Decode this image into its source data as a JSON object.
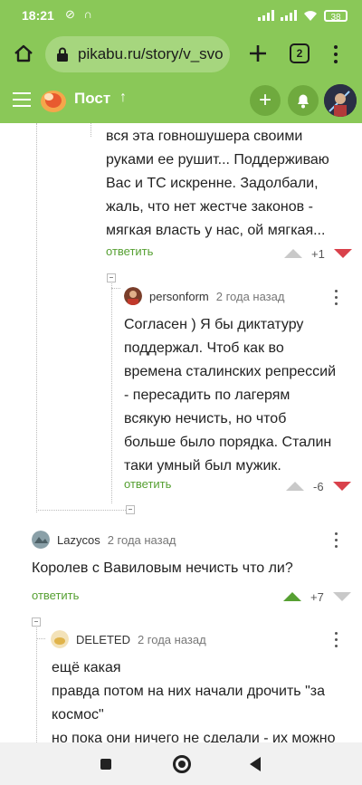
{
  "status_bar": {
    "time": "18:21",
    "left_icons": "⊘ ∩",
    "battery": "38"
  },
  "browser": {
    "url": "pikabu.ru/story/v_svoy",
    "tab_count": "2"
  },
  "site_header": {
    "title": "Пост",
    "arrow": "↑"
  },
  "comments": [
    {
      "lines": [
        "вся эта говношушера своими",
        "руками ее рушит... Поддерживаю",
        "Вас и ТС искренне. Задолбали,",
        "жаль, что нет жестче законов -",
        "мягкая власть у нас, ой мягкая..."
      ],
      "reply": "ответить",
      "rating": "+1"
    },
    {
      "author": "personform",
      "date": "2 года назад",
      "lines": [
        "Согласен ) Я бы диктатуру",
        "поддержал. Чтоб как во",
        "времена сталинских репрессий",
        "- пересадить по лагерям",
        "всякую нечисть, но чтоб",
        "больше было порядка. Сталин",
        "таки умный был мужик."
      ],
      "reply": "ответить",
      "rating": "-6"
    },
    {
      "author": "Lazycos",
      "date": "2 года назад",
      "lines": [
        "Королев с Вавиловым нечисть что ли?"
      ],
      "reply": "ответить",
      "rating": "+7"
    },
    {
      "author": "DELETED",
      "date": "2 года назад",
      "lines": [
        "ещё какая",
        "правда потом на них начали дрочить \"за",
        "космос\"",
        "но пока они ничего не сделали - их можно"
      ]
    }
  ],
  "colors": {
    "brand_green": "#8ac858",
    "reply_green": "#56a032",
    "downvote_red": "#d9414b"
  }
}
